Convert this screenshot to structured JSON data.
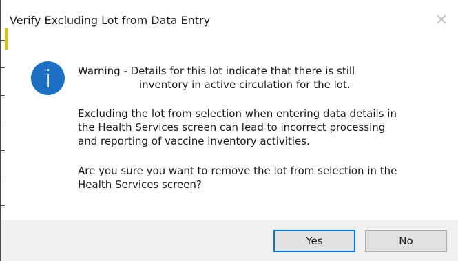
{
  "dialog": {
    "title": "Verify Excluding Lot from Data Entry",
    "close_glyph": "✕",
    "icon": "info-icon",
    "message": {
      "line1": "Warning - Details for this lot indicate that there is still",
      "line2": "inventory in active circulation for the lot.",
      "para2_line1": "Excluding the lot from selection when entering data details in",
      "para2_line2": "the Health Services screen can lead to incorrect processing",
      "para2_line3": "and reporting of vaccine inventory activities.",
      "para3_line1": "Are you sure you want to remove the lot from selection in the",
      "para3_line2": "Health Services screen?"
    },
    "buttons": {
      "yes": "Yes",
      "no": "No"
    },
    "colors": {
      "info_blue": "#1a73c9",
      "default_button_border": "#0078d7",
      "footer_bg": "#f0f0f0"
    }
  }
}
